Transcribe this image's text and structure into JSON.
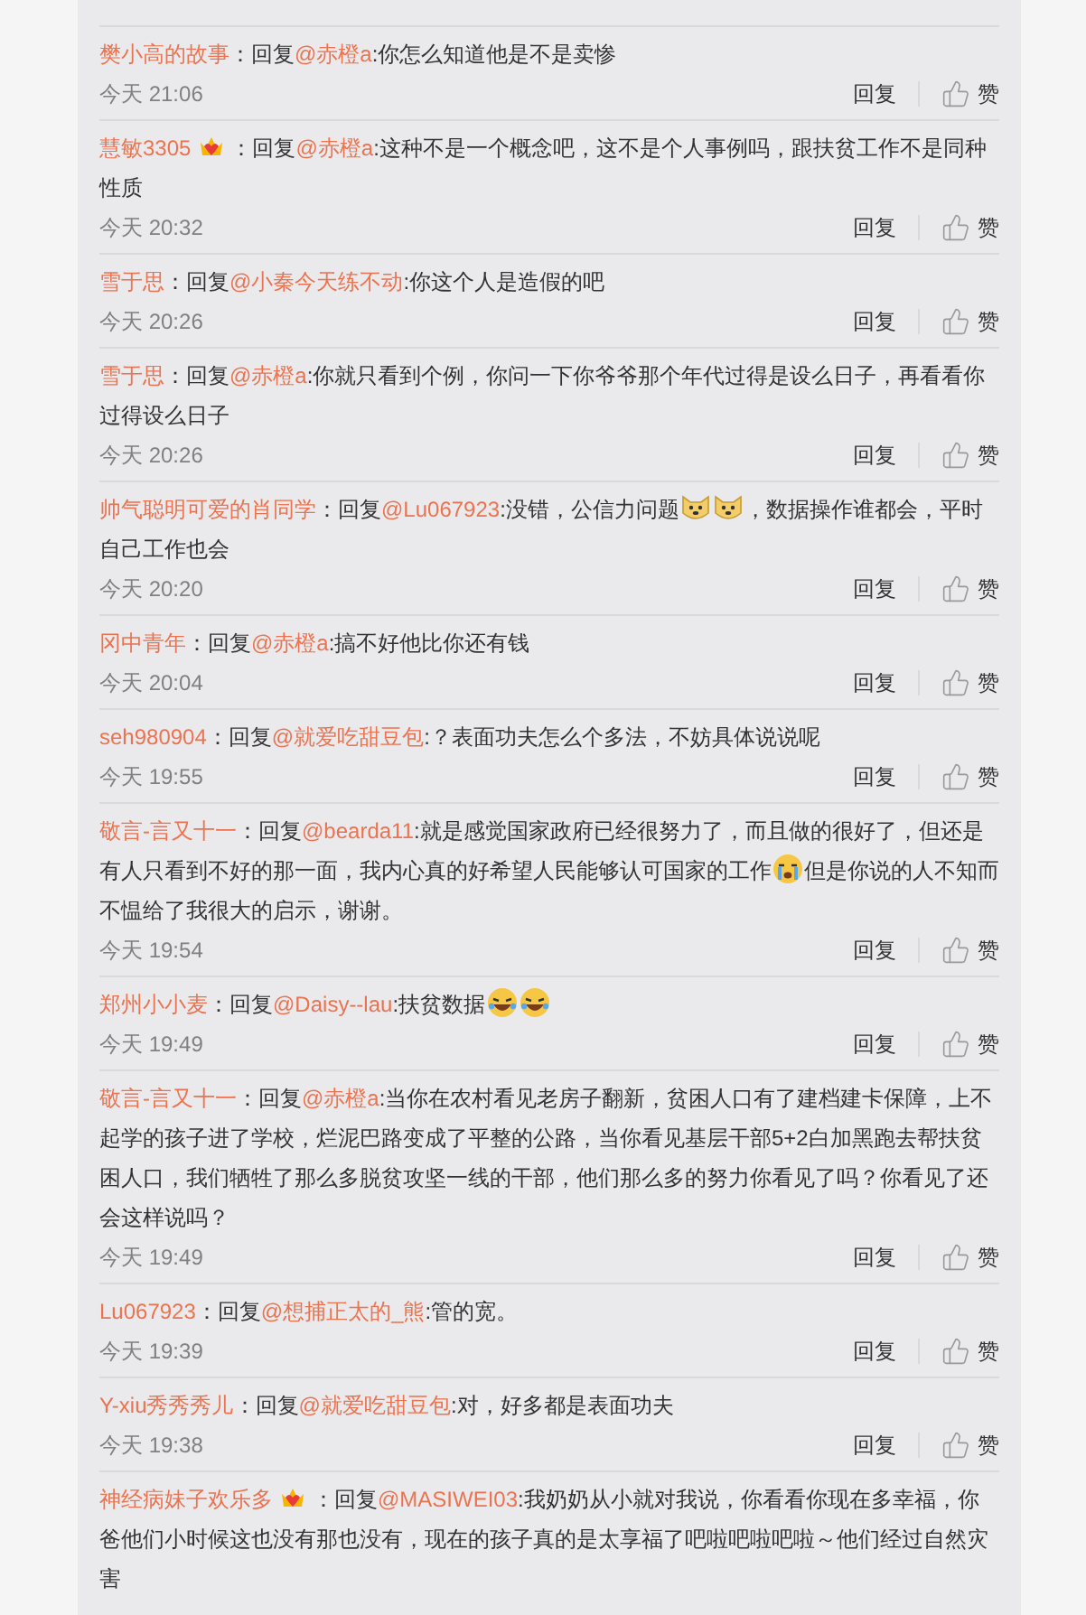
{
  "comments": [
    {
      "user": "樊小高的故事",
      "badge": false,
      "parts": [
        {
          "kind": "text",
          "text": "：回复"
        },
        {
          "kind": "mention",
          "text": "@赤橙a"
        },
        {
          "kind": "text",
          "text": ":你怎么知道他是不是卖惨"
        }
      ],
      "time": "今天 21:06",
      "reply": "回复",
      "like": "赞"
    },
    {
      "user": "慧敏3305",
      "badge": true,
      "parts": [
        {
          "kind": "text",
          "text": "：回复"
        },
        {
          "kind": "mention",
          "text": "@赤橙a"
        },
        {
          "kind": "text",
          "text": ":这种不是一个概念吧，这不是个人事例吗，跟扶贫工作不是同种性质"
        }
      ],
      "time": "今天 20:32",
      "reply": "回复",
      "like": "赞"
    },
    {
      "user": "雪于思",
      "badge": false,
      "parts": [
        {
          "kind": "text",
          "text": "：回复"
        },
        {
          "kind": "mention",
          "text": "@小秦今天练不动"
        },
        {
          "kind": "text",
          "text": ":你这个人是造假的吧"
        }
      ],
      "time": "今天 20:26",
      "reply": "回复",
      "like": "赞"
    },
    {
      "user": "雪于思",
      "badge": false,
      "parts": [
        {
          "kind": "text",
          "text": "：回复"
        },
        {
          "kind": "mention",
          "text": "@赤橙a"
        },
        {
          "kind": "text",
          "text": ":你就只看到个例，你问一下你爷爷那个年代过得是设么日子，再看看你过得设么日子"
        }
      ],
      "time": "今天 20:26",
      "reply": "回复",
      "like": "赞"
    },
    {
      "user": "帅气聪明可爱的肖同学",
      "badge": false,
      "parts": [
        {
          "kind": "text",
          "text": "：回复"
        },
        {
          "kind": "mention",
          "text": "@Lu067923"
        },
        {
          "kind": "text",
          "text": ":没错，公信力问题"
        },
        {
          "kind": "dog"
        },
        {
          "kind": "dog"
        },
        {
          "kind": "text",
          "text": "，数据操作谁都会，平时自己工作也会"
        }
      ],
      "time": "今天 20:20",
      "reply": "回复",
      "like": "赞"
    },
    {
      "user": "冈中青年",
      "badge": false,
      "parts": [
        {
          "kind": "text",
          "text": "：回复"
        },
        {
          "kind": "mention",
          "text": "@赤橙a"
        },
        {
          "kind": "text",
          "text": ":搞不好他比你还有钱"
        }
      ],
      "time": "今天 20:04",
      "reply": "回复",
      "like": "赞"
    },
    {
      "user": "seh980904",
      "badge": false,
      "parts": [
        {
          "kind": "text",
          "text": "：回复"
        },
        {
          "kind": "mention",
          "text": "@就爱吃甜豆包"
        },
        {
          "kind": "text",
          "text": ":？表面功夫怎么个多法，不妨具体说说呢"
        }
      ],
      "time": "今天 19:55",
      "reply": "回复",
      "like": "赞"
    },
    {
      "user": "敬言-言又十一",
      "badge": false,
      "parts": [
        {
          "kind": "text",
          "text": "：回复"
        },
        {
          "kind": "mention",
          "text": "@bearda11"
        },
        {
          "kind": "text",
          "text": ":就是感觉国家政府已经很努力了，而且做的很好了，但还是有人只看到不好的那一面，我内心真的好希望人民能够认可国家的工作"
        },
        {
          "kind": "cry"
        },
        {
          "kind": "text",
          "text": "但是你说的人不知而不愠给了我很大的启示，谢谢。"
        }
      ],
      "time": "今天 19:54",
      "reply": "回复",
      "like": "赞"
    },
    {
      "user": "郑州小小麦",
      "badge": false,
      "parts": [
        {
          "kind": "text",
          "text": "：回复"
        },
        {
          "kind": "mention",
          "text": "@Daisy--lau"
        },
        {
          "kind": "text",
          "text": ":扶贫数据"
        },
        {
          "kind": "laugh"
        },
        {
          "kind": "laugh"
        }
      ],
      "time": "今天 19:49",
      "reply": "回复",
      "like": "赞"
    },
    {
      "user": "敬言-言又十一",
      "badge": false,
      "parts": [
        {
          "kind": "text",
          "text": "：回复"
        },
        {
          "kind": "mention",
          "text": "@赤橙a"
        },
        {
          "kind": "text",
          "text": ":当你在农村看见老房子翻新，贫困人口有了建档建卡保障，上不起学的孩子进了学校，烂泥巴路变成了平整的公路，当你看见基层干部5+2白加黑跑去帮扶贫困人口，我们牺牲了那么多脱贫攻坚一线的干部，他们那么多的努力你看见了吗？你看见了还会这样说吗？"
        }
      ],
      "time": "今天 19:49",
      "reply": "回复",
      "like": "赞"
    },
    {
      "user": "Lu067923",
      "badge": false,
      "parts": [
        {
          "kind": "text",
          "text": "：回复"
        },
        {
          "kind": "mention",
          "text": "@想捕正太的_熊"
        },
        {
          "kind": "text",
          "text": ":管的宽。"
        }
      ],
      "time": "今天 19:39",
      "reply": "回复",
      "like": "赞"
    },
    {
      "user": "Y-xiu秀秀秀儿",
      "badge": false,
      "parts": [
        {
          "kind": "text",
          "text": "：回复"
        },
        {
          "kind": "mention",
          "text": "@就爱吃甜豆包"
        },
        {
          "kind": "text",
          "text": ":对，好多都是表面功夫"
        }
      ],
      "time": "今天 19:38",
      "reply": "回复",
      "like": "赞"
    },
    {
      "user": "神经病妹子欢乐多",
      "badge": true,
      "parts": [
        {
          "kind": "text",
          "text": "：回复"
        },
        {
          "kind": "mention",
          "text": "@MASIWEI03"
        },
        {
          "kind": "text",
          "text": ":我奶奶从小就对我说，你看看你现在多幸福，你爸他们小时候这也没有那也没有，现在的孩子真的是太享福了吧啦吧啦吧啦～他们经过自然灾害"
        }
      ]
    }
  ]
}
